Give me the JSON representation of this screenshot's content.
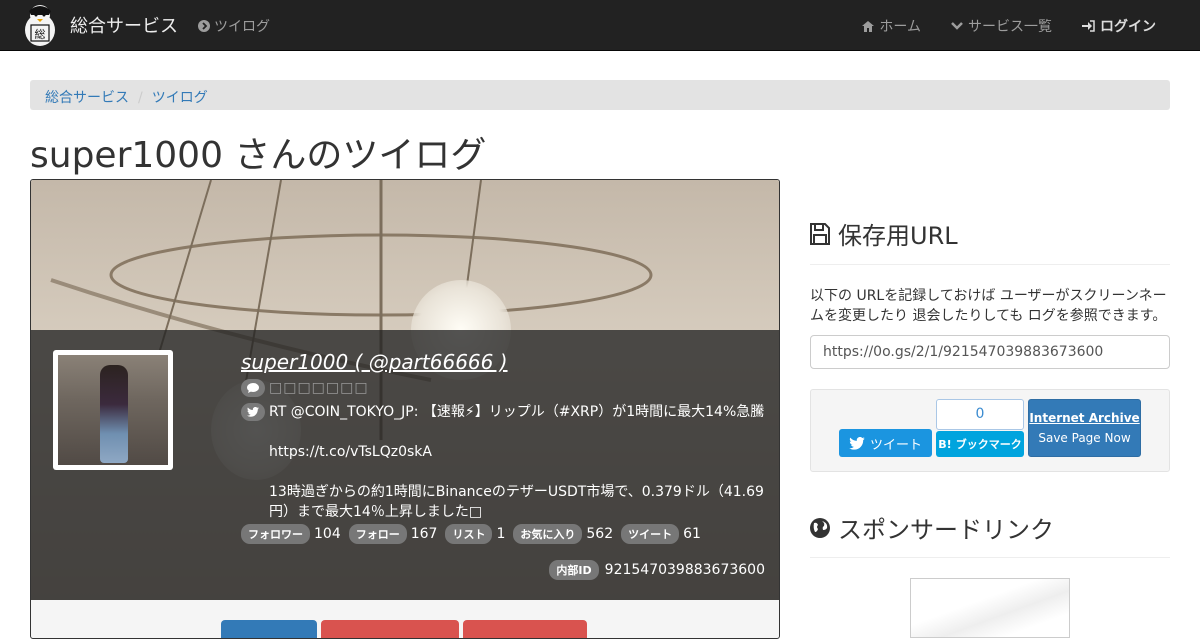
{
  "navbar": {
    "brand": "総合サービス",
    "left_link": "ツイログ",
    "right_links": [
      "ホーム",
      "サービス一覧",
      "ログイン"
    ]
  },
  "breadcrumb": [
    "総合サービス",
    "ツイログ"
  ],
  "page_title": "super1000 さんのツイログ",
  "profile": {
    "name": "super1000 ( @part66666 )",
    "bio": "□□□□□□□",
    "tweet": "RT @COIN_TOKYO_JP: 【速報⚡】リップル（#XRP）が1時間に最大14%急騰\n\nhttps://t.co/vTsLQz0skA\n\n13時過ぎからの約1時間にBinanceのテザーUSDT市場で、0.379ドル（41.69円）まで最大14％上昇しました□",
    "stats": [
      {
        "label": "フォロワー",
        "value": "104"
      },
      {
        "label": "フォロー",
        "value": "167"
      },
      {
        "label": "リスト",
        "value": "1"
      },
      {
        "label": "お気に入り",
        "value": "562"
      },
      {
        "label": "ツイート",
        "value": "61"
      }
    ],
    "internal_id_label": "内部ID",
    "internal_id": "921547039883673600"
  },
  "save_url": {
    "heading": "保存用URL",
    "description": "以下の URLを記録しておけば ユーザーがスクリーンネームを変更したり 退会したりしても ログを参照できます。",
    "url": "https://0o.gs/2/1/921547039883673600"
  },
  "share": {
    "tweet_label": "ツイート",
    "hatena_count": "0",
    "hatena_label": "ブックマーク",
    "ia_title": "Internet Archive",
    "ia_sub": "Save Page Now"
  },
  "sponsor": {
    "heading": "スポンサードリンク"
  },
  "colors": {
    "navbar": "#222222",
    "link": "#337ab7",
    "twitter": "#1b95e0",
    "hatena": "#00a4de"
  }
}
